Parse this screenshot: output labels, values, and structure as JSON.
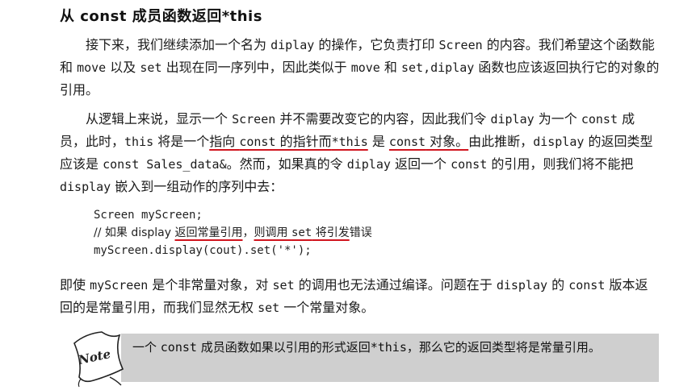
{
  "heading": "从 const 成员函数返回*this",
  "para1": {
    "s1": "接下来，我们继续添加一个名为 ",
    "c1": "diplay",
    "s2": " 的操作，它负责打印 ",
    "c2": "Screen",
    "s3": " 的内容。我们希望这个函数能和 ",
    "c3": "move",
    "s4": " 以及 ",
    "c4": "set",
    "s5": " 出现在同一序列中，因此类似于 ",
    "c5": "move",
    "s6": " 和 ",
    "c6": "set,diplay",
    "s7": " 函数也应该返回执行它的对象的引用。"
  },
  "para2": {
    "s1": "从逻辑上来说，显示一个 ",
    "c1": "Screen",
    "s2": " 并不需要改变它的内容，因此我们令 ",
    "c2": "diplay",
    "s3": " 为一个 ",
    "c3": "const",
    "s4": " 成员，此时，",
    "c4": "this",
    "s5": " 将是一个",
    "u1a": "指向 ",
    "u1b": "const",
    "u1c": " 的指针而",
    "u2": "*this",
    "s6": " 是 ",
    "u3a": "const",
    "u3b": " 对象。",
    "s7": "由此推断，",
    "c5": "display",
    "s8": " 的返回类型应该是 ",
    "c6": "const Sales_data&",
    "s9": "。然而，如果真的令 ",
    "c7": "diplay",
    "s10": " 返回一个 ",
    "c8": "const",
    "s11": " 的引用，则我们将不能把 ",
    "c9": "display",
    "s12": " 嵌入到一组动作的序列中去："
  },
  "code": {
    "line1": "Screen myScreen;",
    "line2_prefix": "// 如果 display ",
    "line2_u1": "返回常量引用",
    "line2_mid": "，",
    "line2_u2a": "则调用 ",
    "line2_u2b": "set",
    "line2_u2c": " 将引发",
    "line2_suffix": "错误",
    "line3": "myScreen.display(cout).set('*');"
  },
  "para3": {
    "s1": "即使 ",
    "c1": "myScreen",
    "s2": " 是个非常量对象，对 ",
    "c2": "set",
    "s3": " 的调用也无法通过编译。问题在于 ",
    "c3": "display",
    "s4": " 的 ",
    "c4": "const",
    "s5": " 版本返回的是常量引用，而我们显然无权 ",
    "c5": "set",
    "s6": " 一个常量对象。"
  },
  "note": {
    "label": "Note",
    "s1": "一个 ",
    "c1": "const",
    "s2": " 成员函数如果以引用的形式返回",
    "c2": "*this",
    "s3": "，那么它的返回类型将是常量引用。"
  },
  "colors": {
    "underline": "#d0141e",
    "note_background": "#cfcfcf"
  }
}
